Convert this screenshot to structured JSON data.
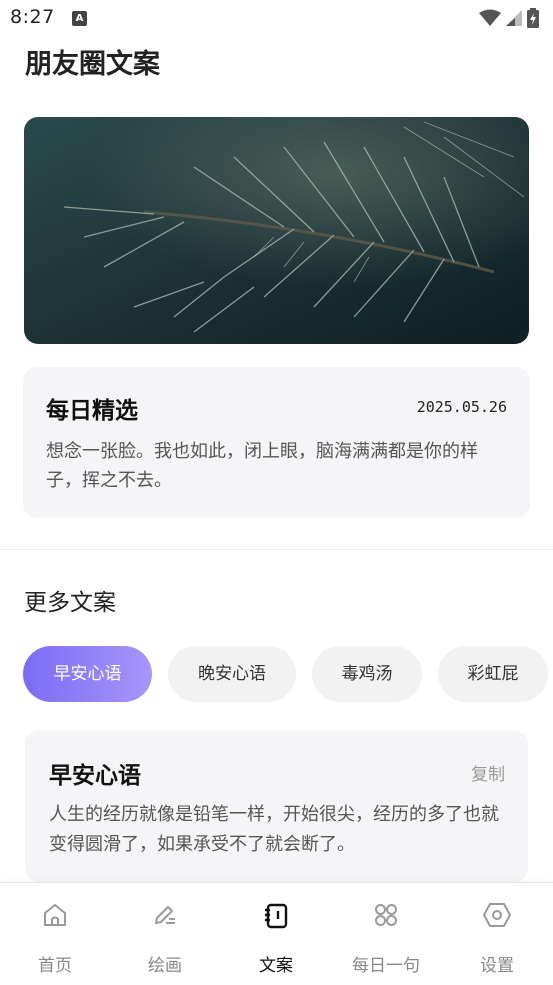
{
  "status_bar": {
    "time": "8:27",
    "notification_icon": "A"
  },
  "app": {
    "title": "朋友圈文案"
  },
  "daily": {
    "title": "每日精选",
    "date": "2025.05.26",
    "text": "想念一张脸。我也如此，闭上眼，脑海满满都是你的样子，挥之不去。"
  },
  "more": {
    "title": "更多文案",
    "categories": [
      "早安心语",
      "晚安心语",
      "毒鸡汤",
      "彩虹屁"
    ],
    "selected": "早安心语"
  },
  "card": {
    "title": "早安心语",
    "copy_label": "复制",
    "text": "人生的经历就像是铅笔一样，开始很尖，经历的多了也就变得圆滑了，如果承受不了就会断了。"
  },
  "tabs": [
    {
      "label": "首页",
      "icon": "home-icon"
    },
    {
      "label": "绘画",
      "icon": "edit-icon"
    },
    {
      "label": "文案",
      "icon": "notebook-icon",
      "active": true
    },
    {
      "label": "每日一句",
      "icon": "apps-icon"
    },
    {
      "label": "设置",
      "icon": "settings-icon"
    }
  ],
  "colors": {
    "accent_start": "#7b6cf6",
    "accent_end": "#a796f8"
  }
}
